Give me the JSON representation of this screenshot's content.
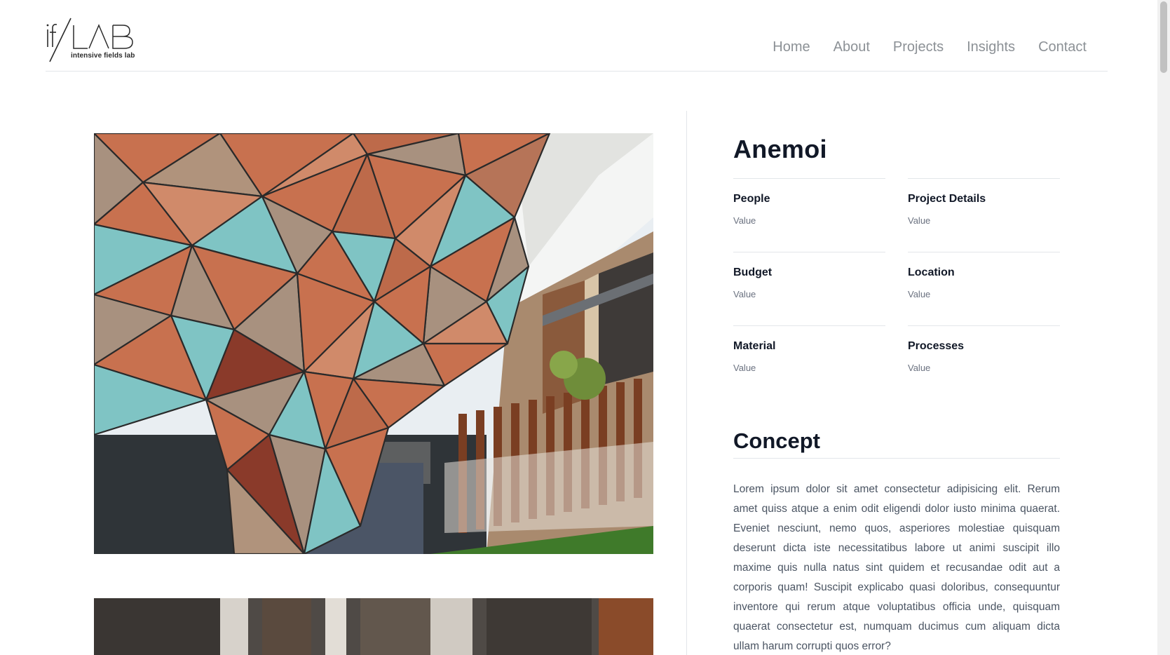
{
  "logo": {
    "mark": "if/LAB",
    "tagline": "intensive fields lab"
  },
  "nav": {
    "items": [
      "Home",
      "About",
      "Projects",
      "Insights",
      "Contact"
    ]
  },
  "project": {
    "title": "Anemoi",
    "details": [
      {
        "label": "People",
        "value": "Value"
      },
      {
        "label": "Project Details",
        "value": "Value"
      },
      {
        "label": "Budget",
        "value": "Value"
      },
      {
        "label": "Location",
        "value": "Value"
      },
      {
        "label": "Material",
        "value": "Value"
      },
      {
        "label": "Processes",
        "value": "Value"
      }
    ],
    "concept_title": "Concept",
    "concept_text": "Lorem ipsum dolor sit amet consectetur adipisicing elit. Rerum amet quiss atque a enim odit eligendi dolor iusto minima quaerat. Eveniet nesciunt, nemo quos, asperiores molestiae quisquam deserunt dicta iste necessitatibus labore ut animi suscipit illo maxime quis nulla natus sint quidem et recusandae odit aut a corporis quam! Suscipit explicabo quasi doloribus, consequuntur inventore qui rerum atque voluptatibus officia unde, quisquam quaerat consectetur est, numquam ducimus cum aliquam dicta ullam harum corrupti quos error?"
  },
  "colors": {
    "copper": "#c8714f",
    "teal": "#7fc4c4",
    "stone": "#a8917f",
    "text_dark": "#111827",
    "nav_gray": "#8c9196"
  }
}
